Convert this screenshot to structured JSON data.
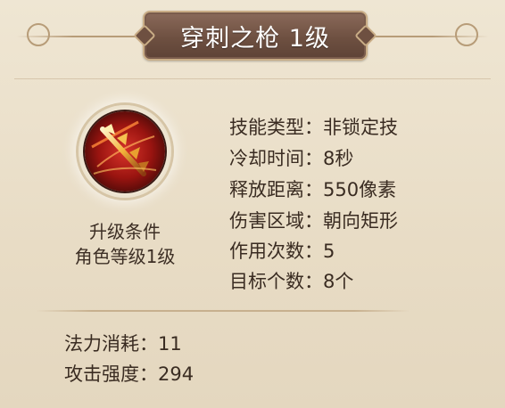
{
  "skill": {
    "title": "穿刺之枪 1级",
    "icon": "spear-skill-icon",
    "upgrade_condition_label": "升级条件",
    "upgrade_condition_value": "角色等级1级"
  },
  "stats": [
    {
      "label": "技能类型：",
      "value": "非锁定技"
    },
    {
      "label": "冷却时间：",
      "value": "8秒"
    },
    {
      "label": "释放距离：",
      "value": "550像素"
    },
    {
      "label": "伤害区域：",
      "value": "朝向矩形"
    },
    {
      "label": "作用次数：",
      "value": "5"
    },
    {
      "label": "目标个数：",
      "value": "8个"
    }
  ],
  "costs": [
    {
      "label": "法力消耗：",
      "value": "11"
    },
    {
      "label": "攻击强度：",
      "value": "294"
    }
  ],
  "colors": {
    "panel_bg": "#e9dfcb",
    "plaque": "#6e5041",
    "plaque_border": "#c9ad86",
    "text": "#3a2c22"
  }
}
